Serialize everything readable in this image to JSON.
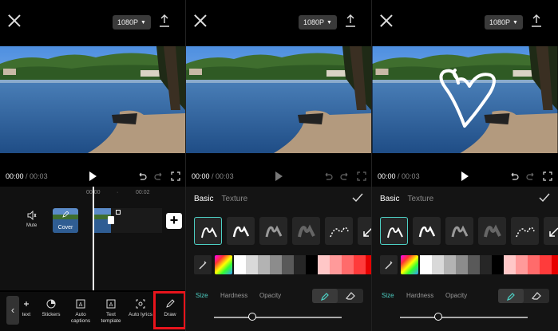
{
  "panels": [
    {
      "resolution": "1080P",
      "time_current": "00:00",
      "time_total": "/ 00:03",
      "ruler": [
        "00:00",
        "00:02"
      ],
      "mute_label": "Mute",
      "cover_label": "Cover",
      "tools": [
        {
          "label": "text",
          "icon": "text-icon"
        },
        {
          "label": "Stickers",
          "icon": "sticker-icon"
        },
        {
          "label": "Auto captions",
          "icon": "auto-captions-icon"
        },
        {
          "label": "Text template",
          "icon": "text-template-icon"
        },
        {
          "label": "Auto lyrics",
          "icon": "auto-lyrics-icon"
        },
        {
          "label": "Draw",
          "icon": "pencil-icon"
        }
      ]
    },
    {
      "resolution": "1080P",
      "time_current": "00:00",
      "time_total": "/ 00:03",
      "tab_basic": "Basic",
      "tab_texture": "Texture",
      "size_label": "Size",
      "hardness_label": "Hardness",
      "opacity_label": "Opacity",
      "size_value": 0.3
    },
    {
      "resolution": "1080P",
      "time_current": "00:00",
      "time_total": "/ 00:03",
      "tab_basic": "Basic",
      "tab_texture": "Texture",
      "size_label": "Size",
      "hardness_label": "Hardness",
      "opacity_label": "Opacity",
      "size_value": 0.3
    }
  ],
  "colors": {
    "accent": "#4dd0c4",
    "highlight": "#e8141c",
    "swatches": [
      "#ffffff",
      "#d9d9d9",
      "#b3b3b3",
      "#8c8c8c",
      "#595959",
      "#262626",
      "#000000",
      "#ffc7c7",
      "#ff9a9a",
      "#ff6b6b",
      "#ff3b3b",
      "#ff1a1a",
      "#e60000"
    ]
  }
}
